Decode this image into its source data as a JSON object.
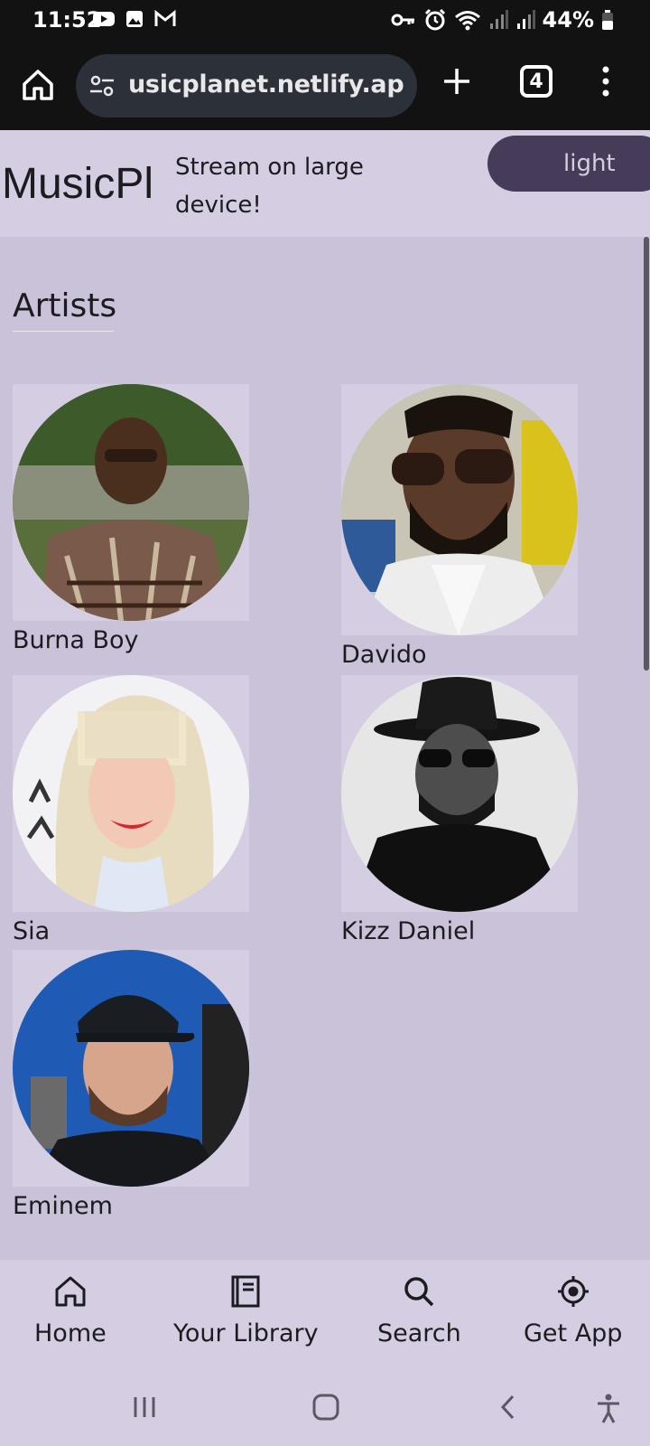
{
  "status_bar": {
    "time": "11:52",
    "battery": "44%",
    "icons": [
      "youtube-icon",
      "gallery-icon",
      "gmail-icon",
      "key-icon",
      "alarm-icon",
      "wifi-icon",
      "signal-icon",
      "signal-icon",
      "battery-icon"
    ]
  },
  "browser": {
    "url": "usicplanet.netlify.app",
    "tab_count": "4"
  },
  "header": {
    "title": "MusicPl",
    "tagline": "Stream on large device!",
    "theme_button": "light"
  },
  "section": {
    "title": "Artists"
  },
  "artists": [
    {
      "name": "Burna Boy"
    },
    {
      "name": "Davido"
    },
    {
      "name": "Sia"
    },
    {
      "name": "Kizz Daniel"
    },
    {
      "name": "Eminem"
    }
  ],
  "bottom_nav": [
    {
      "label": "Home",
      "icon": "home-icon"
    },
    {
      "label": "Your Library",
      "icon": "library-icon"
    },
    {
      "label": "Search",
      "icon": "search-icon"
    },
    {
      "label": "Get App",
      "icon": "location-target-icon"
    }
  ],
  "colors": {
    "page_bg": "#cac2d9",
    "header_bg": "#d5cde2",
    "theme_button_bg": "#463b58",
    "browser_bg": "#121212"
  }
}
